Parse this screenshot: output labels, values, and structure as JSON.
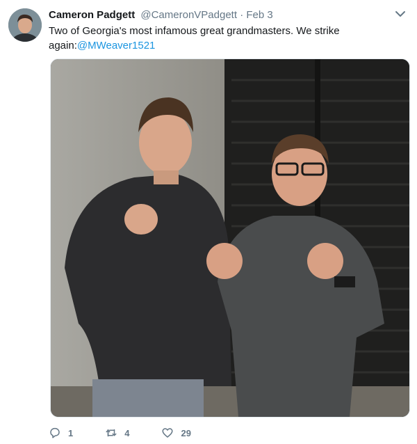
{
  "tweet": {
    "author_name": "Cameron Padgett",
    "author_handle": "@CameronVPadgett",
    "separator": "·",
    "date": "Feb 3",
    "text_before_mention": "Two of Georgia's most infamous great grandmasters. We strike again:",
    "mention": "@MWeaver1521",
    "avatar_icon": "user-avatar",
    "menu_icon": "chevron-down-icon"
  },
  "actions": {
    "reply_count": "1",
    "retweet_count": "4",
    "like_count": "29",
    "reply_icon": "reply-icon",
    "retweet_icon": "retweet-icon",
    "like_icon": "heart-icon"
  },
  "colors": {
    "link": "#1b95e0",
    "secondary_text": "#657786",
    "primary_text": "#14171a"
  }
}
